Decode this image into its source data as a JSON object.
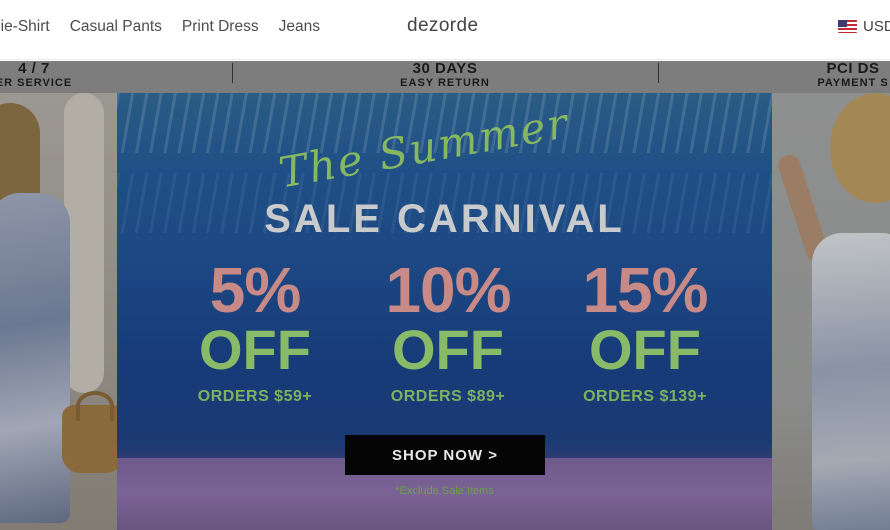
{
  "header": {
    "nav": [
      "bie-Shirt",
      "Casual Pants",
      "Print Dress",
      "Jeans"
    ],
    "logo": "dezorde",
    "currency": "USD",
    "flag_icon": "us-flag-icon"
  },
  "service_strip": [
    {
      "big": "4 / 7",
      "small": "ER SERVICE"
    },
    {
      "big": "30 DAYS",
      "small": "EASY RETURN"
    },
    {
      "big": "PCI DS",
      "small": "PAYMENT S"
    }
  ],
  "banner": {
    "script_title": "The Summer",
    "headline": "SALE CARNIVAL",
    "offers": [
      {
        "pct": "5%",
        "off": "OFF",
        "min": "ORDERS $59+"
      },
      {
        "pct": "10%",
        "off": "OFF",
        "min": "ORDERS $89+"
      },
      {
        "pct": "15%",
        "off": "OFF",
        "min": "ORDERS $139+"
      }
    ],
    "button": "SHOP NOW >",
    "footnote": "*Exclude Sale Items"
  },
  "colors": {
    "accent_green": "#86b862",
    "accent_pink": "#c78a86",
    "banner_blue": "#1c4783",
    "button_black": "#050505"
  }
}
